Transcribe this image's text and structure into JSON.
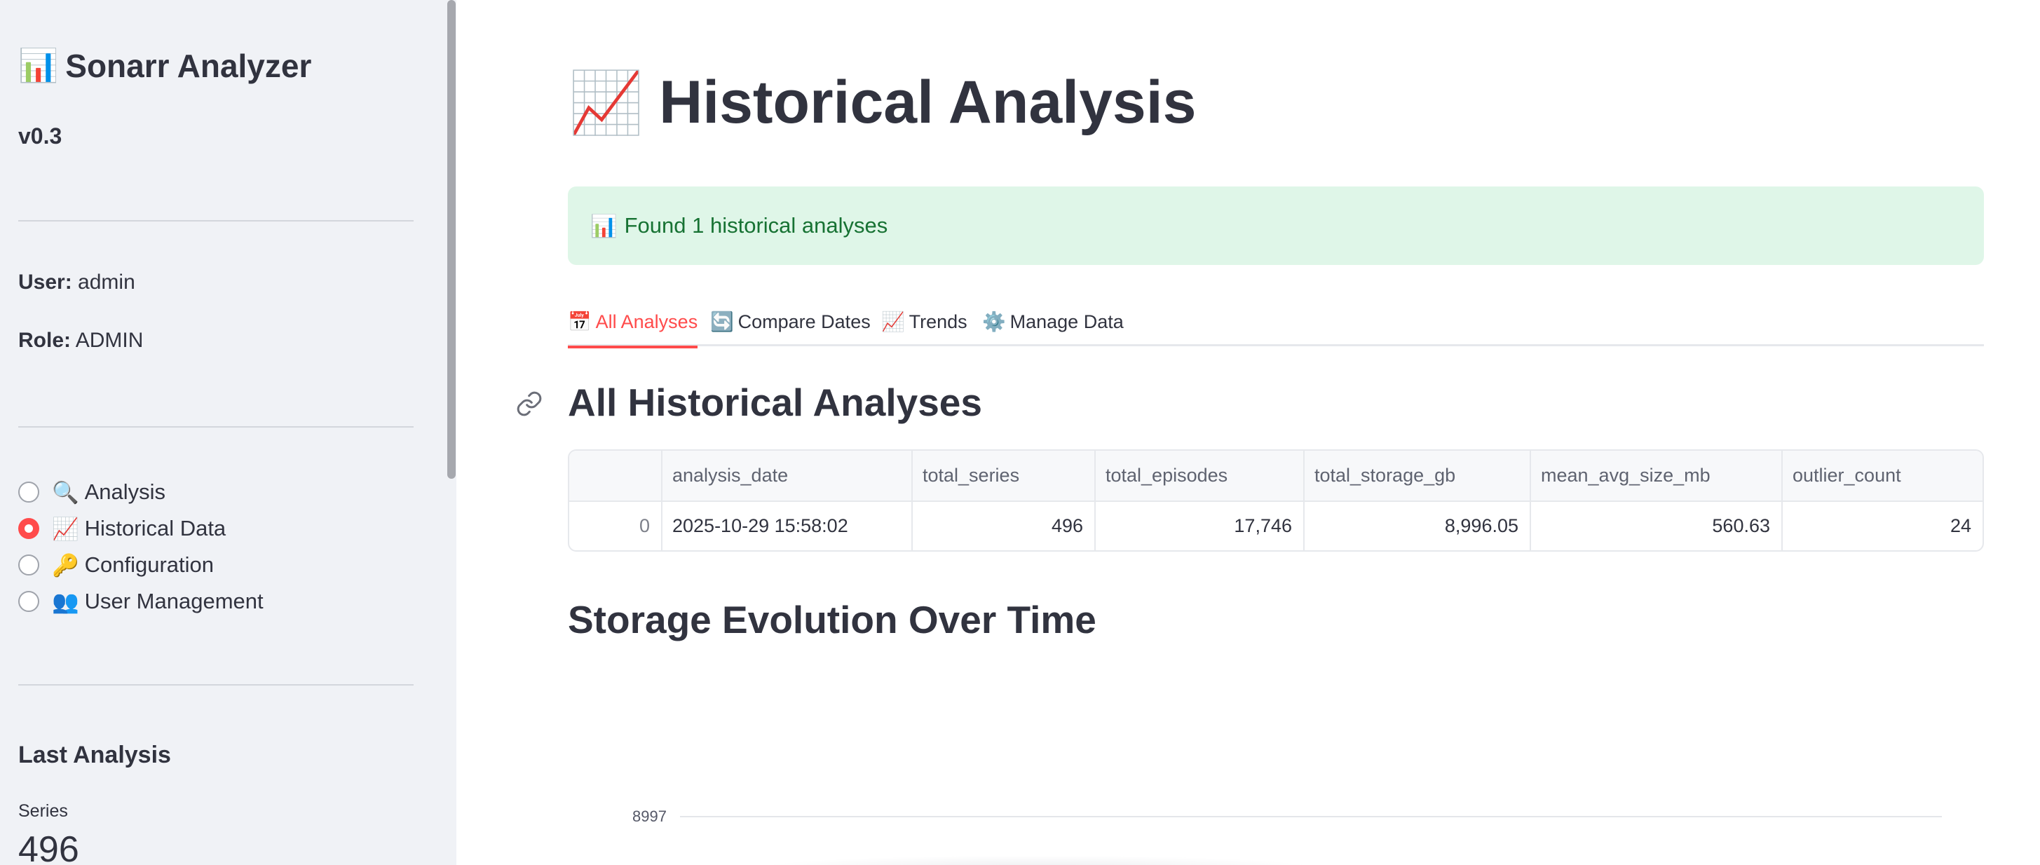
{
  "sidebar": {
    "app_icon": "bar-chart-emoji",
    "app_icon_glyph": "📊",
    "app_title": "Sonarr Analyzer",
    "version": "v0.3",
    "user_label": "User:",
    "user_value": "admin",
    "role_label": "Role:",
    "role_value": "ADMIN",
    "nav": [
      {
        "icon": "magnifier-emoji",
        "glyph": "🔍",
        "label": "Analysis",
        "selected": false
      },
      {
        "icon": "chart-increasing-emoji",
        "glyph": "📈",
        "label": "Historical Data",
        "selected": true
      },
      {
        "icon": "key-emoji",
        "glyph": "🔑",
        "label": "Configuration",
        "selected": false
      },
      {
        "icon": "users-emoji",
        "glyph": "👥",
        "label": "User Management",
        "selected": false
      }
    ],
    "last_analysis_title": "Last Analysis",
    "metric_label": "Series",
    "metric_value": "496"
  },
  "main": {
    "title_glyph": "📈",
    "title": "Historical Analysis",
    "alert_glyph": "📊",
    "alert_text": "Found 1 historical analyses",
    "tabs": [
      {
        "glyph": "📅",
        "label": "All Analyses",
        "active": true
      },
      {
        "glyph": "🔄",
        "label": "Compare Dates",
        "active": false
      },
      {
        "glyph": "📈",
        "label": "Trends",
        "active": false
      },
      {
        "glyph": "⚙️",
        "label": "Manage Data",
        "active": false
      }
    ],
    "section1_title": "All Historical Analyses",
    "table": {
      "columns": [
        "",
        "analysis_date",
        "total_series",
        "total_episodes",
        "total_storage_gb",
        "mean_avg_size_mb",
        "outlier_count"
      ],
      "rows": [
        [
          "0",
          "2025-10-29 15:58:02",
          "496",
          "17,746",
          "8,996.05",
          "560.63",
          "24"
        ]
      ]
    },
    "section2_title": "Storage Evolution Over Time",
    "chart_y_tick": "8997"
  },
  "colors": {
    "accent": "#ff4b4b",
    "sidebar_bg": "#f0f2f6",
    "alert_bg": "#dff6e8",
    "alert_text": "#177233",
    "text": "#31333f"
  }
}
